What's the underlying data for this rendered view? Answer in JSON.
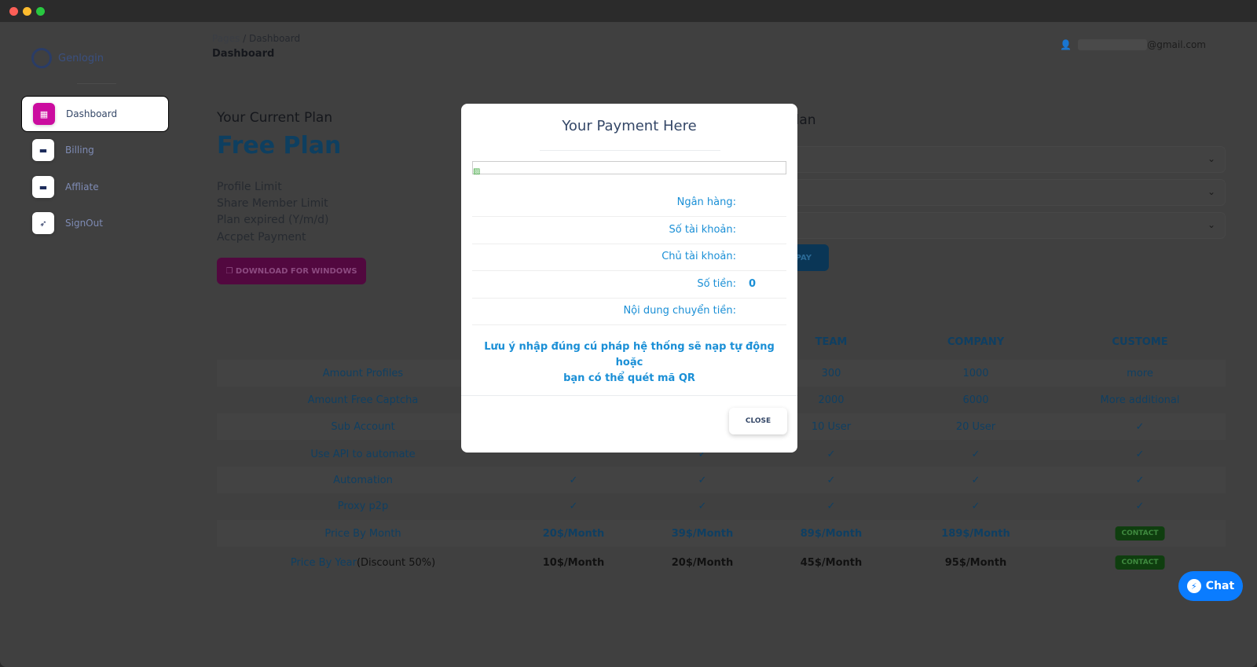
{
  "window": {
    "controls": [
      "close",
      "minimize",
      "maximize"
    ],
    "colors": {
      "close": "#fe5f57",
      "minimize": "#febc2e",
      "maximize": "#28c840"
    }
  },
  "sidebar": {
    "logo_text": "Genlogin",
    "items": [
      {
        "label": "Dashboard",
        "icon": "shop-icon",
        "active": true
      },
      {
        "label": "Billing",
        "icon": "credit-card-icon"
      },
      {
        "label": "Affliate",
        "icon": "credit-card-icon"
      },
      {
        "label": "SignOut",
        "icon": "rocket-icon"
      }
    ]
  },
  "header": {
    "breadcrumb_root": "Pages",
    "breadcrumb_sep": "/",
    "breadcrumb_current": "Dashboard",
    "title": "Dashboard",
    "user_email_suffix": "@gmail.com"
  },
  "current_plan": {
    "heading": "Your Current Plan",
    "plan_name": "Free Plan",
    "limits": [
      "Profile Limit",
      "Share Member Limit",
      "Plan expired (Y/m/d)",
      "Accpet Payment"
    ],
    "download_label": "DOWNLOAD FOR WINDOWS"
  },
  "upgrade": {
    "heading_visible": "r Plan",
    "select_2_partial": "n",
    "pay_label": "PAY"
  },
  "table": {
    "headers": [
      "",
      "",
      "",
      "TEAM",
      "COMPANY",
      "CUSTOME"
    ],
    "rows": [
      {
        "label": "Amount Profiles",
        "cells": [
          "",
          "",
          "300",
          "1000",
          "more"
        ]
      },
      {
        "label": "Amount Free Captcha",
        "cells": [
          "",
          "",
          "2000",
          "6000",
          "More additional"
        ]
      },
      {
        "label": "Sub Account",
        "cells": [
          "",
          "",
          "10 User",
          "20 User",
          "✓"
        ]
      },
      {
        "label": "Use API to automate",
        "cells": [
          "",
          "✓",
          "✓",
          "✓",
          "✓"
        ]
      },
      {
        "label": "Automation",
        "cells": [
          "✓",
          "✓",
          "✓",
          "✓",
          "✓"
        ]
      },
      {
        "label": "Proxy p2p",
        "cells": [
          "✓",
          "✓",
          "✓",
          "✓",
          "✓"
        ]
      },
      {
        "label": "Price By Month",
        "cells": [
          "20$/Month",
          "39$/Month",
          "89$/Month",
          "189$/Month",
          "CONTACT"
        ]
      },
      {
        "label": "Price By Year",
        "label_suffix": "(Discount 50%)",
        "cells": [
          "10$/Month",
          "20$/Month",
          "45$/Month",
          "95$/Month",
          "CONTACT"
        ]
      }
    ]
  },
  "modal": {
    "title": "Your Payment Here",
    "fields": [
      {
        "label": "Ngân hàng:",
        "value": ""
      },
      {
        "label": "Số tài khoản:",
        "value": ""
      },
      {
        "label": "Chủ tài khoản:",
        "value": ""
      },
      {
        "label": "Số tiền:",
        "value": "0"
      },
      {
        "label": "Nội dung chuyển tiền:",
        "value": ""
      }
    ],
    "note_line1": "Lưu ý nhập đúng cú pháp hệ thống sẽ nạp tự động hoặc",
    "note_line2": "bạn có thể quét mã QR",
    "close_label": "CLOSE"
  },
  "chat": {
    "label": "Chat"
  }
}
